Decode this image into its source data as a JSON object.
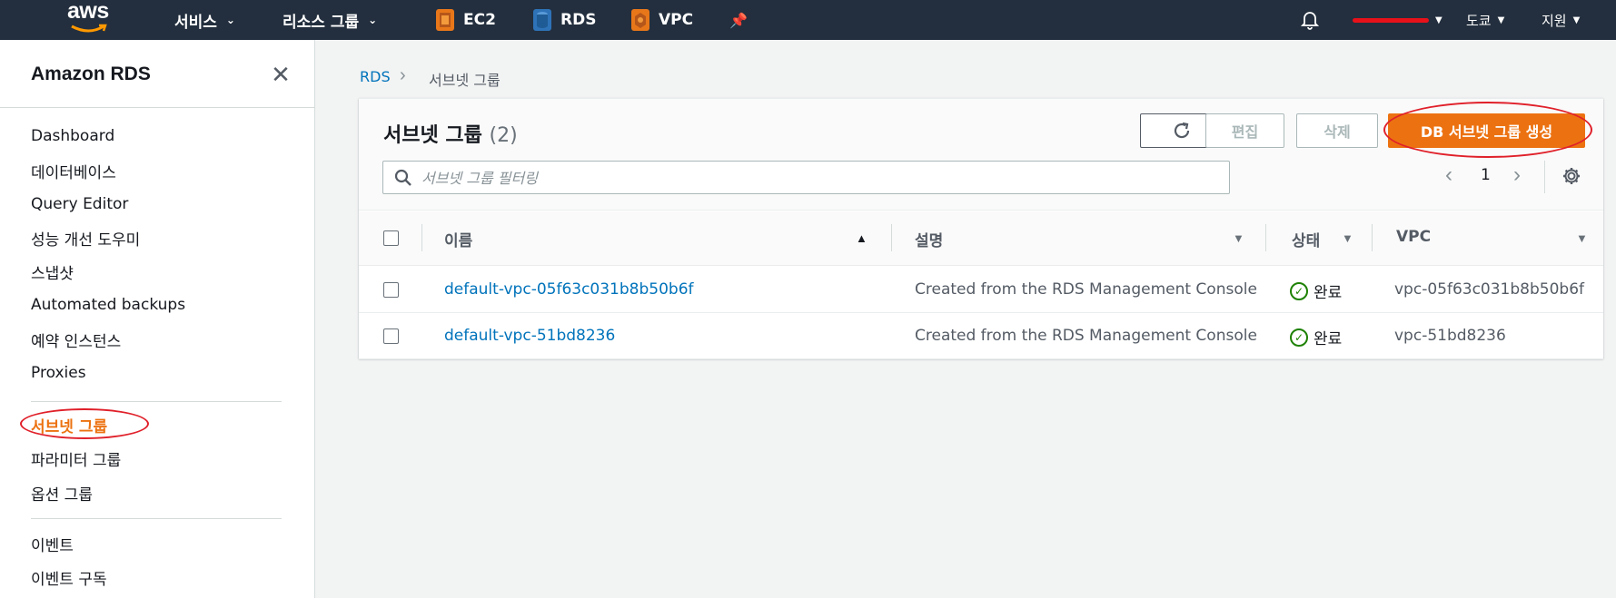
{
  "topnav": {
    "logo": "aws",
    "services_label": "서비스",
    "resource_groups_label": "리소스 그룹",
    "pinned": [
      {
        "label": "EC2",
        "icon": "ec2-icon",
        "color": "#e8771a"
      },
      {
        "label": "RDS",
        "icon": "rds-icon",
        "color": "#2e73b8"
      },
      {
        "label": "VPC",
        "icon": "vpc-icon",
        "color": "#e8771a"
      }
    ],
    "tools_label": "도쿄",
    "support_label": "지원"
  },
  "sidebar": {
    "title": "Amazon RDS",
    "items_group1": [
      "Dashboard",
      "데이터베이스",
      "Query Editor",
      "성능 개선 도우미",
      "스냅샷",
      "Automated backups",
      "예약 인스턴스",
      "Proxies"
    ],
    "items_group2": [
      "서브넷 그룹",
      "파라미터 그룹",
      "옵션 그룹"
    ],
    "items_group3": [
      "이벤트",
      "이벤트 구독"
    ],
    "active_item": "서브넷 그룹"
  },
  "breadcrumb": {
    "root": "RDS",
    "current": "서브넷 그룹"
  },
  "panel": {
    "title": "서브넷 그룹",
    "count": "(2)",
    "edit_label": "편집",
    "delete_label": "삭제",
    "create_label": "DB 서브넷 그룹 생성",
    "search_placeholder": "서브넷 그룹 필터링",
    "page": "1"
  },
  "table": {
    "columns": [
      "이름",
      "설명",
      "상태",
      "VPC"
    ],
    "rows": [
      {
        "name": "default-vpc-05f63c031b8b50b6f",
        "description": "Created from the RDS Management Console",
        "status": "완료",
        "vpc": "vpc-05f63c031b8b50b6f"
      },
      {
        "name": "default-vpc-51bd8236",
        "description": "Created from the RDS Management Console",
        "status": "완료",
        "vpc": "vpc-51bd8236"
      }
    ]
  },
  "colors": {
    "accent": "#ec7211",
    "link": "#0073bb",
    "nav_bg": "#232f3e",
    "success": "#1d8102",
    "annotation": "#e0202a"
  }
}
